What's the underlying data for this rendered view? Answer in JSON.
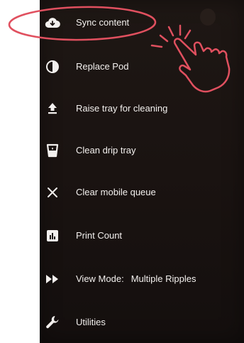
{
  "menu": {
    "items": [
      {
        "label": "Sync content",
        "icon": "cloud-download-icon"
      },
      {
        "label": "Replace Pod",
        "icon": "half-circle-icon"
      },
      {
        "label": "Raise tray for cleaning",
        "icon": "upload-arrow-icon"
      },
      {
        "label": "Clean drip tray",
        "icon": "drip-tray-icon"
      },
      {
        "label": "Clear mobile queue",
        "icon": "close-icon"
      },
      {
        "label": "Print Count",
        "icon": "bar-chart-icon"
      },
      {
        "label": "View Mode:",
        "value": "Multiple Ripples",
        "icon": "fast-forward-icon"
      },
      {
        "label": "Utilities",
        "icon": "wrench-icon"
      }
    ]
  },
  "colors": {
    "panel_bg": "#1a1311",
    "text": "#f3f0ee",
    "annotation": "#e0505f"
  }
}
